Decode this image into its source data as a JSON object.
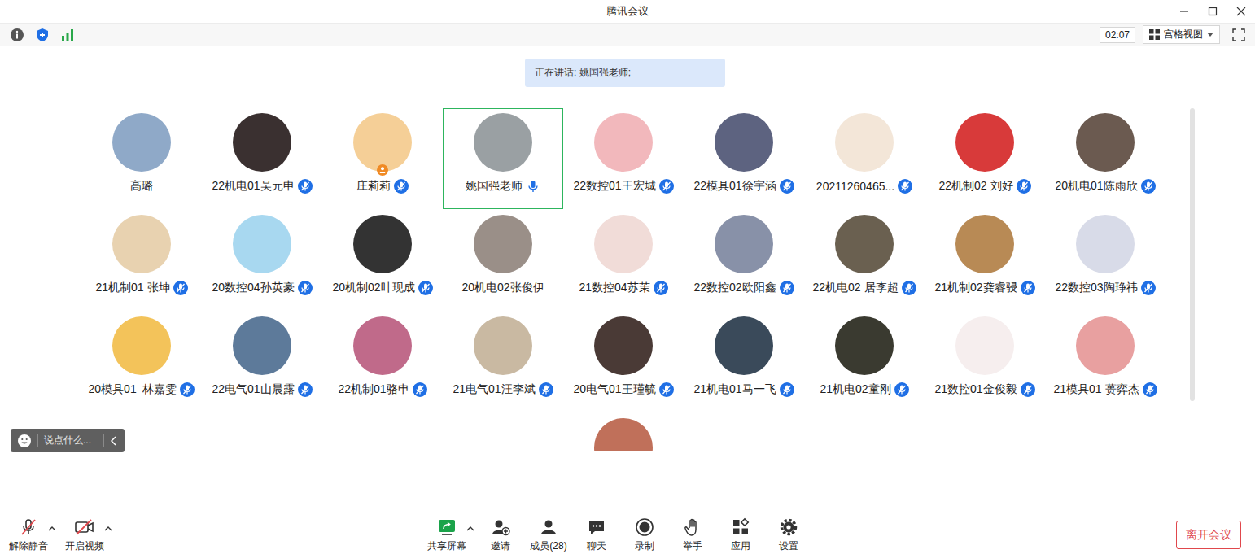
{
  "window": {
    "title": "腾讯会议"
  },
  "toolbar": {
    "timer": "02:07",
    "view": "宫格视图"
  },
  "speaking": "正在讲话: 姚国强老师;",
  "participants": [
    {
      "name": "高璐",
      "mic": "none",
      "host": false,
      "selected": false,
      "color": "#8fa9c8"
    },
    {
      "name": "22机电01吴元申",
      "mic": "muted",
      "host": false,
      "selected": false,
      "color": "#3a3030"
    },
    {
      "name": "庄莉莉",
      "mic": "muted",
      "host": true,
      "selected": false,
      "color": "#f5cf97"
    },
    {
      "name": "姚国强老师",
      "mic": "speaking",
      "host": false,
      "selected": true,
      "color": "#9aa0a3"
    },
    {
      "name": "22数控01王宏城",
      "mic": "muted",
      "host": false,
      "selected": false,
      "color": "#f2b8bc"
    },
    {
      "name": "22模具01徐宇涵",
      "mic": "muted",
      "host": false,
      "selected": false,
      "color": "#5d6380"
    },
    {
      "name": "20211260465...",
      "mic": "muted",
      "host": false,
      "selected": false,
      "color": "#f3e6d8"
    },
    {
      "name": "22机制02 刘好",
      "mic": "muted",
      "host": false,
      "selected": false,
      "color": "#d83a3a"
    },
    {
      "name": "20机电01陈雨欣",
      "mic": "muted",
      "host": false,
      "selected": false,
      "color": "#6b5a50"
    },
    {
      "name": "21机制01 张坤",
      "mic": "muted",
      "host": false,
      "selected": false,
      "color": "#e8d2b0"
    },
    {
      "name": "20数控04孙英豪",
      "mic": "muted",
      "host": false,
      "selected": false,
      "color": "#a8d8f0"
    },
    {
      "name": "20机制02叶现成",
      "mic": "muted",
      "host": false,
      "selected": false,
      "color": "#333333"
    },
    {
      "name": "20机电02张俊伊",
      "mic": "none",
      "host": false,
      "selected": false,
      "color": "#9a8f88"
    },
    {
      "name": "21数控04苏茉",
      "mic": "muted",
      "host": false,
      "selected": false,
      "color": "#f1dcd8"
    },
    {
      "name": "22数控02欧阳鑫",
      "mic": "muted",
      "host": false,
      "selected": false,
      "color": "#8891a8"
    },
    {
      "name": "22机电02 居李超",
      "mic": "muted",
      "host": false,
      "selected": false,
      "color": "#6a6050"
    },
    {
      "name": "21机制02龚睿骎",
      "mic": "muted",
      "host": false,
      "selected": false,
      "color": "#b88a55"
    },
    {
      "name": "22数控03陶琤祎",
      "mic": "muted",
      "host": false,
      "selected": false,
      "color": "#d8dbe8"
    },
    {
      "name": "20模具01  林嘉雯",
      "mic": "muted",
      "host": false,
      "selected": false,
      "color": "#f3c35a"
    },
    {
      "name": "22电气01山晨露",
      "mic": "muted",
      "host": false,
      "selected": false,
      "color": "#5d7a9a"
    },
    {
      "name": "22机制01骆申",
      "mic": "muted",
      "host": false,
      "selected": false,
      "color": "#c06a8a"
    },
    {
      "name": "21电气01汪李斌",
      "mic": "muted",
      "host": false,
      "selected": false,
      "color": "#c9b9a2"
    },
    {
      "name": "20电气01王瑾毓",
      "mic": "muted",
      "host": false,
      "selected": false,
      "color": "#4a3a36"
    },
    {
      "name": "21机电01马一飞",
      "mic": "muted",
      "host": false,
      "selected": false,
      "color": "#3a4a5a"
    },
    {
      "name": "21机电02童刚",
      "mic": "muted",
      "host": false,
      "selected": false,
      "color": "#3a3a30"
    },
    {
      "name": "21数控01金俊毅",
      "mic": "muted",
      "host": false,
      "selected": false,
      "color": "#f6eeee"
    },
    {
      "name": "21模具01 蒉弈杰",
      "mic": "muted",
      "host": false,
      "selected": false,
      "color": "#e8a0a0"
    },
    {
      "name": "",
      "mic": "none",
      "host": false,
      "selected": false,
      "color": "#c0705a"
    }
  ],
  "chat": {
    "placeholder": "说点什么..."
  },
  "bottom_left": [
    {
      "label": "解除静音",
      "kind": "mic",
      "on": false,
      "menu": true
    },
    {
      "label": "开启视频",
      "kind": "video",
      "on": false,
      "menu": true
    }
  ],
  "bottom_center": [
    {
      "label": "共享屏幕",
      "kind": "share",
      "menu": true
    },
    {
      "label": "邀请",
      "kind": "invite",
      "menu": false
    },
    {
      "label": "成员(28)",
      "kind": "members",
      "menu": false
    },
    {
      "label": "聊天",
      "kind": "chat",
      "menu": false
    },
    {
      "label": "录制",
      "kind": "record",
      "menu": false
    },
    {
      "label": "举手",
      "kind": "hand",
      "menu": false
    },
    {
      "label": "应用",
      "kind": "apps",
      "menu": false
    },
    {
      "label": "设置",
      "kind": "settings",
      "menu": false
    }
  ],
  "leave": "离开会议"
}
